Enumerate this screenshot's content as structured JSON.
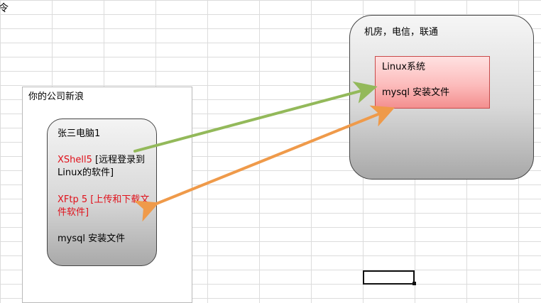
{
  "corner_mark": "令",
  "company": {
    "label": "你的公司新浪"
  },
  "computer": {
    "title": "张三电脑1",
    "xshell_name": "XShell5",
    "xshell_desc": " [远程登录到Linux的软件]",
    "xftp_text": "XFtp 5 [上传和下载文件软件]",
    "mysql_file": "mysql 安装文件"
  },
  "server": {
    "label": "机房，电信，联通",
    "linux": {
      "title": "Linux系统",
      "mysql_file": "mysql 安装文件"
    }
  },
  "colors": {
    "xshell_arrow": "#93b95a",
    "xftp_arrow": "#ef9a4a",
    "red_text": "#e0101a"
  },
  "icons": [
    "green-connection-arrow",
    "orange-transfer-arrow"
  ]
}
